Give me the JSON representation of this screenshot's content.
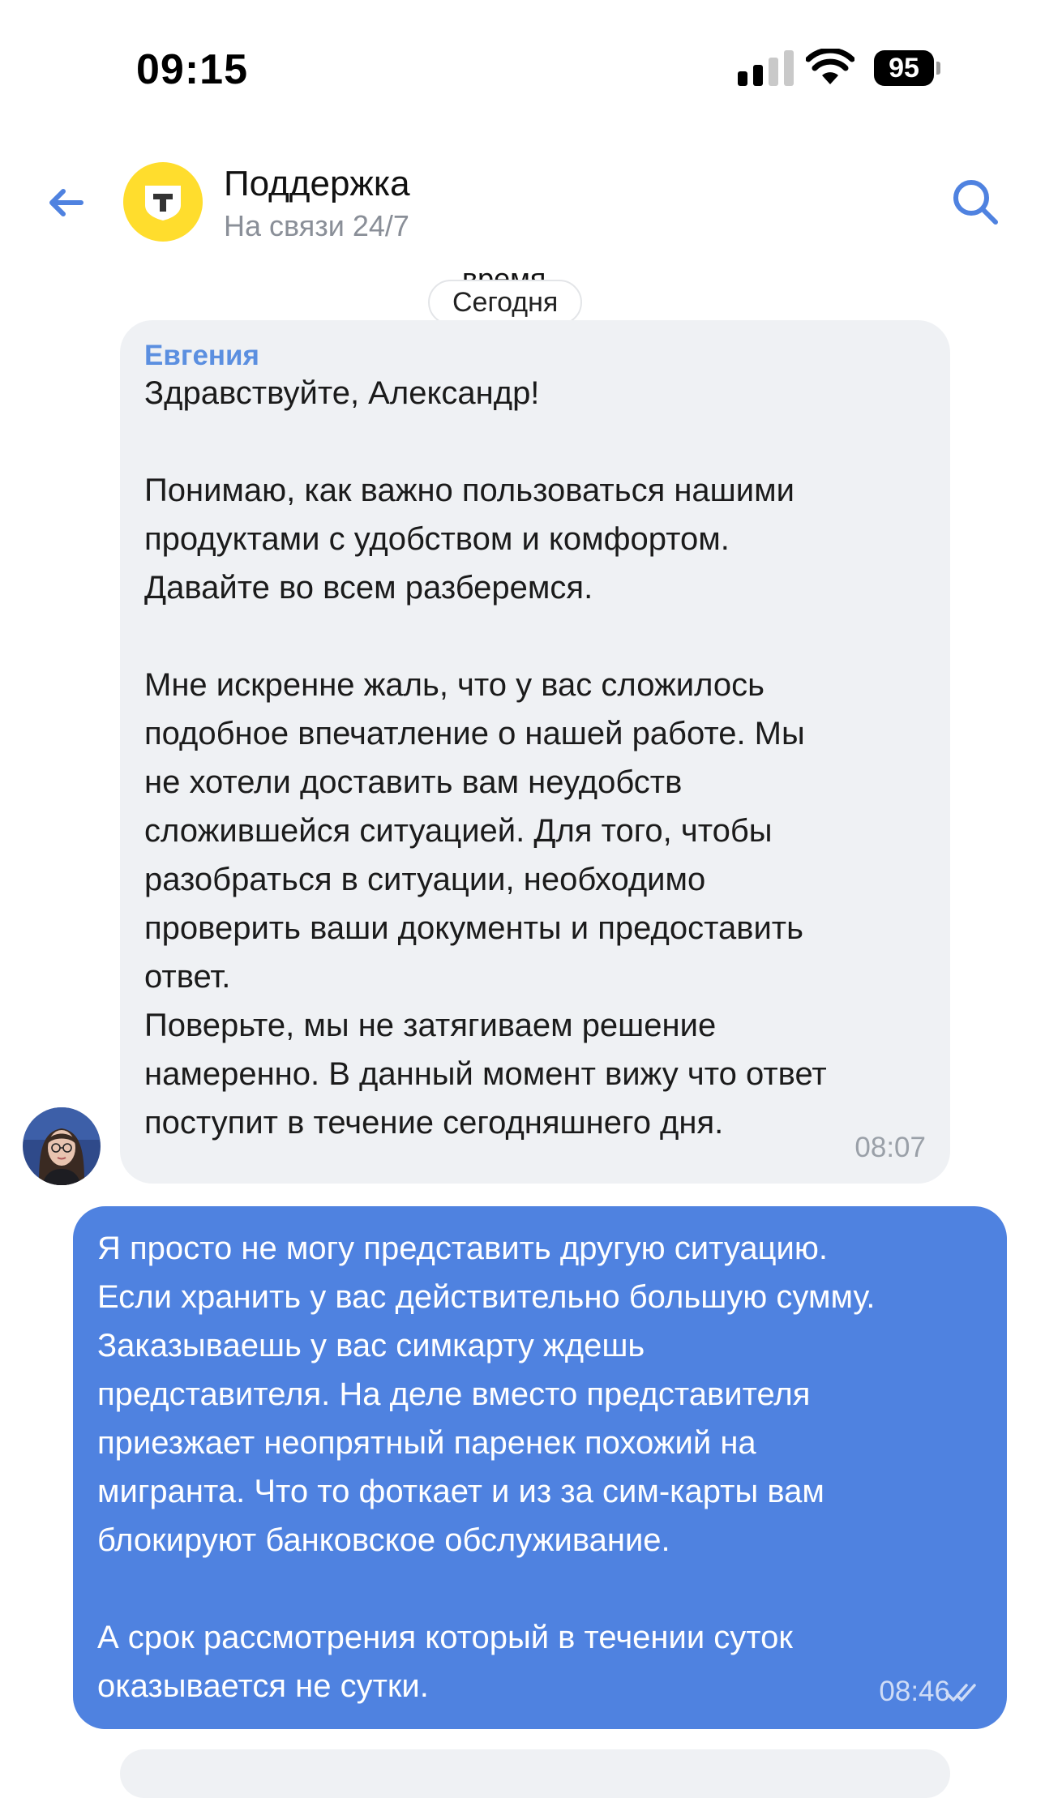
{
  "status_bar": {
    "time": "09:15",
    "battery": "95"
  },
  "header": {
    "title": "Поддержка",
    "subtitle": "На связи 24/7",
    "logo_letter": "Т",
    "logo_color": "#ffdd2d"
  },
  "chat": {
    "previous_fragment": "время.",
    "date_separator": "Сегодня",
    "messages": [
      {
        "direction": "incoming",
        "sender": "Евгения",
        "paragraphs": [
          [
            "Здравствуйте, Александр!"
          ],
          [
            "Понимаю, как важно пользоваться нашими",
            "продуктами с удобством и комфортом.",
            "Давайте во всем разберемся."
          ],
          [
            "Мне искренне жаль, что у вас сложилось",
            "подобное впечатление о нашей работе. Мы",
            "не хотели доставить вам неудобств",
            "сложившейся ситуацией. Для того, чтобы",
            "разобраться в ситуации, необходимо",
            "проверить ваши документы и предоставить",
            "ответ.",
            "Поверьте, мы не затягиваем решение",
            "намеренно. В данный момент вижу что ответ",
            "поступит в течение сегодняшнего дня."
          ]
        ],
        "time": "08:07"
      },
      {
        "direction": "outgoing",
        "paragraphs": [
          [
            "Я просто не могу представить другую ситуацию.",
            "Если хранить у вас действительно большую сумму.",
            "Заказываешь у вас симкарту ждешь",
            "представителя. На деле вместо представителя",
            "приезжает неопрятный паренек похожий на",
            "мигранта. Что то фоткает и из за сим-карты вам",
            "блокируют банковское обслуживание."
          ],
          [
            "А срок рассмотрения который в течении суток",
            "оказывается не сутки."
          ]
        ],
        "time": "08:46",
        "status": "read"
      }
    ]
  },
  "colors": {
    "accent": "#4f82e0",
    "incoming_bubble": "#eff1f4",
    "sender_name": "#5b8fe0"
  }
}
